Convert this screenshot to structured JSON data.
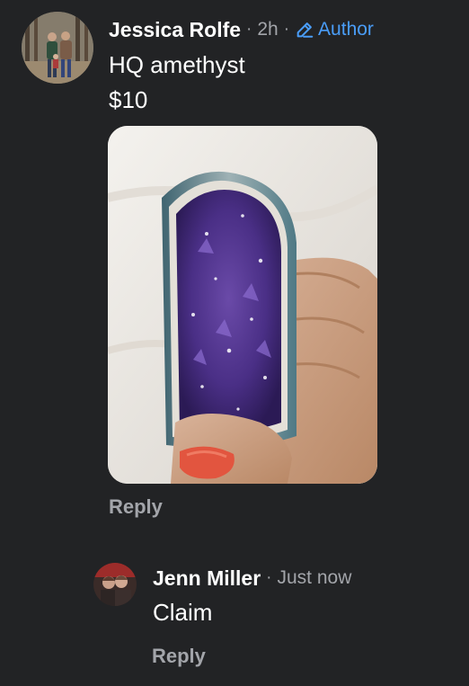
{
  "comment": {
    "author": "Jessica Rolfe",
    "time": "2h",
    "separator": "·",
    "author_badge": "Author",
    "text_lines": [
      "HQ amethyst",
      "$10"
    ],
    "attachment": "amethyst-geode-photo",
    "reply_label": "Reply"
  },
  "reply": {
    "author": "Jenn Miller",
    "separator": "·",
    "time": "Just now",
    "text": "Claim",
    "reply_label": "Reply"
  },
  "colors": {
    "background": "#222325",
    "primary_text": "#ffffff",
    "secondary_text": "#a3a5aa",
    "author_badge": "#4a9df8"
  },
  "icons": {
    "author_badge": "pencil-icon"
  }
}
